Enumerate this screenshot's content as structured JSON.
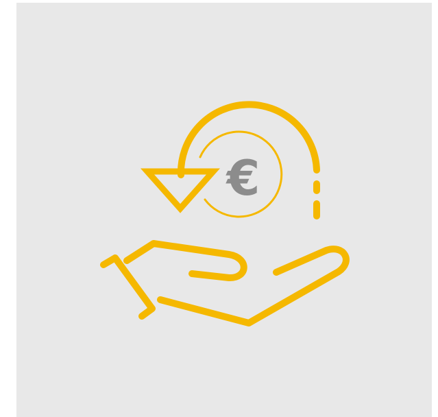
{
  "icon": {
    "name": "refund-hand-euro-icon",
    "currency_symbol": "€"
  },
  "colors": {
    "background": "#e8e8e8",
    "page": "#ffffff",
    "accent": "#f5b800",
    "symbol": "#8c8c8c"
  }
}
